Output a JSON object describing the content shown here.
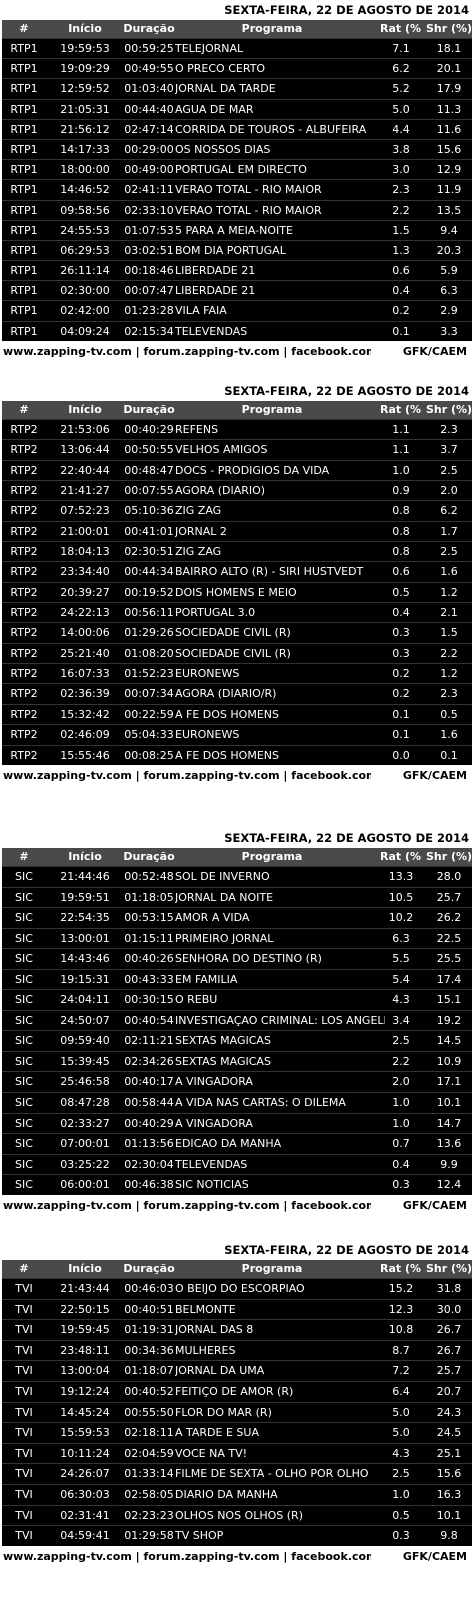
{
  "headers": {
    "channel": "#",
    "start": "Início",
    "duration": "Duração",
    "program": "Programa",
    "rating": "Rat (%)",
    "share": "Shr (%)"
  },
  "footer": {
    "links": "www.zapping-tv.com | forum.zapping-tv.com | facebook.com/zapping.p",
    "source": "GFK/CAEM"
  },
  "sections": [
    {
      "date": "SEXTA-FEIRA, 22 DE AGOSTO DE 2014",
      "rows": [
        [
          "RTP1",
          "19:59:53",
          "00:59:25",
          "TELEJORNAL",
          "7.1",
          "18.1"
        ],
        [
          "RTP1",
          "19:09:29",
          "00:49:55",
          "O PRECO CERTO",
          "6.2",
          "20.1"
        ],
        [
          "RTP1",
          "12:59:52",
          "01:03:40",
          "JORNAL DA TARDE",
          "5.2",
          "17.9"
        ],
        [
          "RTP1",
          "21:05:31",
          "00:44:40",
          "AGUA DE MAR",
          "5.0",
          "11.3"
        ],
        [
          "RTP1",
          "21:56:12",
          "02:47:14",
          "CORRIDA DE TOUROS - ALBUFEIRA",
          "4.4",
          "11.6"
        ],
        [
          "RTP1",
          "14:17:33",
          "00:29:00",
          "OS NOSSOS DIAS",
          "3.8",
          "15.6"
        ],
        [
          "RTP1",
          "18:00:00",
          "00:49:00",
          "PORTUGAL EM DIRECTO",
          "3.0",
          "12.9"
        ],
        [
          "RTP1",
          "14:46:52",
          "02:41:11",
          "VERAO TOTAL - RIO MAIOR",
          "2.3",
          "11.9"
        ],
        [
          "RTP1",
          "09:58:56",
          "02:33:10",
          "VERAO TOTAL - RIO MAIOR",
          "2.2",
          "13.5"
        ],
        [
          "RTP1",
          "24:55:53",
          "01:07:53",
          "5 PARA A MEIA-NOITE",
          "1.5",
          "9.4"
        ],
        [
          "RTP1",
          "06:29:53",
          "03:02:51",
          "BOM DIA PORTUGAL",
          "1.3",
          "20.3"
        ],
        [
          "RTP1",
          "26:11:14",
          "00:18:46",
          "LIBERDADE 21",
          "0.6",
          "5.9"
        ],
        [
          "RTP1",
          "02:30:00",
          "00:07:47",
          "LIBERDADE 21",
          "0.4",
          "6.3"
        ],
        [
          "RTP1",
          "02:42:00",
          "01:23:28",
          "VILA FAIA",
          "0.2",
          "2.9"
        ],
        [
          "RTP1",
          "04:09:24",
          "02:15:34",
          "TELEVENDAS",
          "0.1",
          "3.3"
        ]
      ]
    },
    {
      "date": "SEXTA-FEIRA, 22 DE AGOSTO DE 2014",
      "rows": [
        [
          "RTP2",
          "21:53:06",
          "00:40:29",
          "REFENS",
          "1.1",
          "2.3"
        ],
        [
          "RTP2",
          "13:06:44",
          "00:50:55",
          "VELHOS AMIGOS",
          "1.1",
          "3.7"
        ],
        [
          "RTP2",
          "22:40:44",
          "00:48:47",
          "DOCS - PRODIGIOS DA VIDA",
          "1.0",
          "2.5"
        ],
        [
          "RTP2",
          "21:41:27",
          "00:07:55",
          "AGORA (DIARIO)",
          "0.9",
          "2.0"
        ],
        [
          "RTP2",
          "07:52:23",
          "05:10:36",
          "ZIG ZAG",
          "0.8",
          "6.2"
        ],
        [
          "RTP2",
          "21:00:01",
          "00:41:01",
          "JORNAL 2",
          "0.8",
          "1.7"
        ],
        [
          "RTP2",
          "18:04:13",
          "02:30:51",
          "ZIG ZAG",
          "0.8",
          "2.5"
        ],
        [
          "RTP2",
          "23:34:40",
          "00:44:34",
          "BAIRRO ALTO (R) - SIRI HUSTVEDT",
          "0.6",
          "1.6"
        ],
        [
          "RTP2",
          "20:39:27",
          "00:19:52",
          "DOIS HOMENS E MEIO",
          "0.5",
          "1.2"
        ],
        [
          "RTP2",
          "24:22:13",
          "00:56:11",
          "PORTUGAL 3.0",
          "0.4",
          "2.1"
        ],
        [
          "RTP2",
          "14:00:06",
          "01:29:26",
          "SOCIEDADE CIVIL (R)",
          "0.3",
          "1.5"
        ],
        [
          "RTP2",
          "25:21:40",
          "01:08:20",
          "SOCIEDADE CIVIL (R)",
          "0.3",
          "2.2"
        ],
        [
          "RTP2",
          "16:07:33",
          "01:52:23",
          "EURONEWS",
          "0.2",
          "1.2"
        ],
        [
          "RTP2",
          "02:36:39",
          "00:07:34",
          "AGORA (DIARIO/R)",
          "0.2",
          "2.3"
        ],
        [
          "RTP2",
          "15:32:42",
          "00:22:59",
          "A FE DOS HOMENS",
          "0.1",
          "0.5"
        ],
        [
          "RTP2",
          "02:46:09",
          "05:04:33",
          "EURONEWS",
          "0.1",
          "1.6"
        ],
        [
          "RTP2",
          "15:55:46",
          "00:08:25",
          "A FE DOS HOMENS",
          "0.0",
          "0.1"
        ]
      ]
    },
    {
      "date": "SEXTA-FEIRA, 22 DE AGOSTO DE 2014",
      "rows": [
        [
          "SIC",
          "21:44:46",
          "00:52:48",
          "SOL DE INVERNO",
          "13.3",
          "28.0"
        ],
        [
          "SIC",
          "19:59:51",
          "01:18:05",
          "JORNAL DA NOITE",
          "10.5",
          "25.7"
        ],
        [
          "SIC",
          "22:54:35",
          "00:53:15",
          "AMOR A VIDA",
          "10.2",
          "26.2"
        ],
        [
          "SIC",
          "13:00:01",
          "01:15:11",
          "PRIMEIRO JORNAL",
          "6.3",
          "22.5"
        ],
        [
          "SIC",
          "14:43:46",
          "00:40:26",
          "SENHORA DO DESTINO (R)",
          "5.5",
          "25.5"
        ],
        [
          "SIC",
          "19:15:31",
          "00:43:33",
          "EM FAMILIA",
          "5.4",
          "17.4"
        ],
        [
          "SIC",
          "24:04:11",
          "00:30:15",
          "O REBU",
          "4.3",
          "15.1"
        ],
        [
          "SIC",
          "24:50:07",
          "00:40:54",
          "INVESTIGAÇAO CRIMINAL: LOS ANGELES",
          "3.4",
          "19.2"
        ],
        [
          "SIC",
          "09:59:40",
          "02:11:21",
          "SEXTAS MAGICAS",
          "2.5",
          "14.5"
        ],
        [
          "SIC",
          "15:39:45",
          "02:34:26",
          "SEXTAS MAGICAS",
          "2.2",
          "10.9"
        ],
        [
          "SIC",
          "25:46:58",
          "00:40:17",
          "A VINGADORA",
          "2.0",
          "17.1"
        ],
        [
          "SIC",
          "08:47:28",
          "00:58:44",
          "A VIDA NAS CARTAS: O DILEMA",
          "1.0",
          "10.1"
        ],
        [
          "SIC",
          "02:33:27",
          "00:40:29",
          "A VINGADORA",
          "1.0",
          "14.7"
        ],
        [
          "SIC",
          "07:00:01",
          "01:13:56",
          "EDICAO DA MANHA",
          "0.7",
          "13.6"
        ],
        [
          "SIC",
          "03:25:22",
          "02:30:04",
          "TELEVENDAS",
          "0.4",
          "9.9"
        ],
        [
          "SIC",
          "06:00:01",
          "00:46:38",
          "SIC NOTICIAS",
          "0.3",
          "12.4"
        ]
      ]
    },
    {
      "date": "SEXTA-FEIRA, 22 DE AGOSTO DE 2014",
      "rows": [
        [
          "TVI",
          "21:43:44",
          "00:46:03",
          "O BEIJO DO ESCORPIAO",
          "15.2",
          "31.8"
        ],
        [
          "TVI",
          "22:50:15",
          "00:40:51",
          "BELMONTE",
          "12.3",
          "30.0"
        ],
        [
          "TVI",
          "19:59:45",
          "01:19:31",
          "JORNAL DAS 8",
          "10.8",
          "26.7"
        ],
        [
          "TVI",
          "23:48:11",
          "00:34:36",
          "MULHERES",
          "8.7",
          "26.7"
        ],
        [
          "TVI",
          "13:00:04",
          "01:18:07",
          "JORNAL DA UMA",
          "7.2",
          "25.7"
        ],
        [
          "TVI",
          "19:12:24",
          "00:40:52",
          "FEITIÇO DE AMOR (R)",
          "6.4",
          "20.7"
        ],
        [
          "TVI",
          "14:45:24",
          "00:55:50",
          "FLOR DO MAR (R)",
          "5.0",
          "24.3"
        ],
        [
          "TVI",
          "15:59:53",
          "02:18:11",
          "A TARDE E SUA",
          "5.0",
          "24.5"
        ],
        [
          "TVI",
          "10:11:24",
          "02:04:59",
          "VOCE NA TV!",
          "4.3",
          "25.1"
        ],
        [
          "TVI",
          "24:26:07",
          "01:33:14",
          "FILME DE SEXTA - OLHO POR OLHO",
          "2.5",
          "15.6"
        ],
        [
          "TVI",
          "06:30:03",
          "02:58:05",
          "DIARIO DA MANHA",
          "1.0",
          "16.3"
        ],
        [
          "TVI",
          "02:31:41",
          "02:23:23",
          "OLHOS NOS OLHOS (R)",
          "0.5",
          "10.1"
        ],
        [
          "TVI",
          "04:59:41",
          "01:29:58",
          "TV SHOP",
          "0.3",
          "9.8"
        ]
      ]
    }
  ]
}
